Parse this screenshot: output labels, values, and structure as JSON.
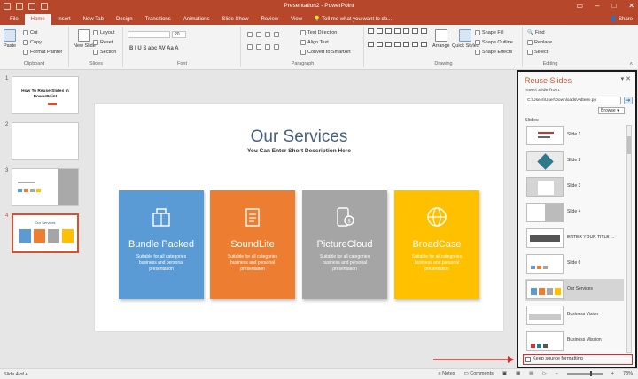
{
  "window": {
    "title": "Presentation2 - PowerPoint"
  },
  "tabs": [
    "File",
    "Home",
    "Insert",
    "New Tab",
    "Design",
    "Transitions",
    "Animations",
    "Slide Show",
    "Review",
    "View"
  ],
  "active_tab": "Home",
  "tell_me": "Tell me what you want to do...",
  "share": "Share",
  "ribbon": {
    "clipboard": {
      "label": "Clipboard",
      "paste": "Paste",
      "cut": "Cut",
      "copy": "Copy",
      "format_painter": "Format Painter"
    },
    "slides": {
      "label": "Slides",
      "new_slide": "New Slide",
      "layout": "Layout",
      "reset": "Reset",
      "section": "Section"
    },
    "font": {
      "label": "Font",
      "size": "20",
      "format_buttons": "B I U S abc AV Aa A"
    },
    "paragraph": {
      "label": "Paragraph",
      "text_direction": "Text Direction",
      "align_text": "Align Text",
      "smartart": "Convert to SmartArt"
    },
    "drawing": {
      "label": "Drawing",
      "arrange": "Arrange",
      "quick_styles": "Quick Styles",
      "shape_fill": "Shape Fill",
      "shape_outline": "Shape Outline",
      "shape_effects": "Shape Effects"
    },
    "editing": {
      "label": "Editing",
      "find": "Find",
      "replace": "Replace",
      "select": "Select"
    }
  },
  "thumbnails": [
    {
      "num": "1",
      "title": "How To Reuse Slides In PowerPoint"
    },
    {
      "num": "2"
    },
    {
      "num": "3"
    },
    {
      "num": "4",
      "title": "Our Services"
    }
  ],
  "slide": {
    "title": "Our Services",
    "subtitle": "You Can Enter Short Description Here",
    "cards": [
      {
        "title": "Bundle Packed",
        "desc": "Suitable for all categories business and personal presentation",
        "color": "#5a9bd5"
      },
      {
        "title": "SoundLite",
        "desc": "Suitable for all categories business and personal presentation",
        "color": "#ed7d31"
      },
      {
        "title": "PictureCloud",
        "desc": "Suitable for all categories business and personal presentation",
        "color": "#a5a5a5"
      },
      {
        "title": "BroadCase",
        "desc": "Suitable for all categories business and personal presentation",
        "color": "#ffc000"
      }
    ]
  },
  "reuse": {
    "title": "Reuse Slides",
    "insert_from": "Insert slide from:",
    "path": "C:\\Users\\User\\Downloads\\Adtemi.pp",
    "browse": "Browse",
    "slides_label": "Slides:",
    "slides": [
      "Slide 1",
      "Slide 2",
      "Slide 3",
      "Slide 4",
      "ENTER YOUR TITLE ...",
      "Slide 6",
      "Our Services",
      "Business Vision",
      "Business Mission"
    ],
    "active_index": 6,
    "keep_formatting": "Keep source formatting"
  },
  "status": {
    "slide_of": "Slide 4 of 4",
    "notes": "Notes",
    "comments": "Comments",
    "zoom": "73%"
  }
}
